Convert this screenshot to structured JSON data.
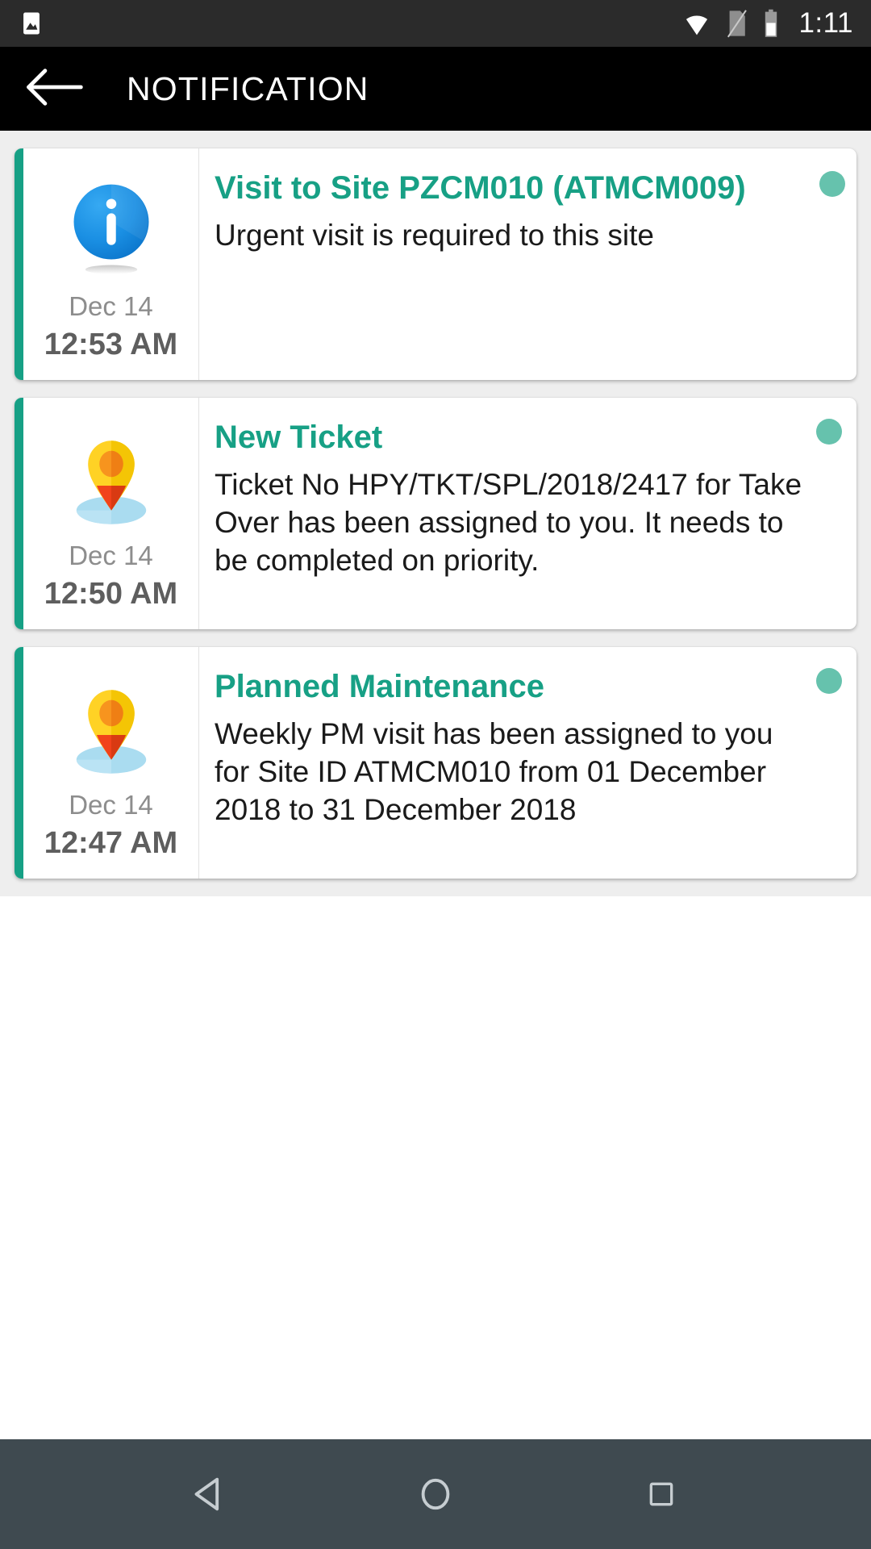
{
  "statusbar": {
    "time": "1:11",
    "icons": {
      "gallery": "gallery-icon",
      "wifi": "wifi-icon",
      "sim": "sim-card-off-icon",
      "battery": "battery-icon"
    }
  },
  "appbar": {
    "back_label": "back-arrow",
    "title": "NOTIFICATION"
  },
  "colors": {
    "accent_teal": "#16a085",
    "title_teal": "#17a085",
    "status_dot": "#66c2ad",
    "statusbar_bg": "#2b2b2b",
    "appbar_bg": "#000000",
    "list_bg": "#eeeeee",
    "navbar_bg": "#3f4a50",
    "info_icon_blue": "#1a8fe3",
    "pin_yellow": "#ffd225",
    "pin_orange": "#f7941e",
    "pin_tip_red": "#f1421b",
    "pin_shadow_blue": "#aadcf0"
  },
  "notifications": [
    {
      "icon": "info-circle-icon",
      "date": "Dec 14",
      "time": "12:53 AM",
      "title": "Visit to Site PZCM010 (ATMCM009)",
      "body": "Urgent visit is required to this site",
      "unread": true
    },
    {
      "icon": "map-pin-icon",
      "date": "Dec 14",
      "time": "12:50 AM",
      "title": "New Ticket",
      "body": "Ticket No HPY/TKT/SPL/2018/2417 for Take Over has been assigned to you. It needs to be completed on priority.",
      "unread": true
    },
    {
      "icon": "map-pin-icon",
      "date": "Dec 14",
      "time": "12:47 AM",
      "title": "Planned Maintenance",
      "body": "Weekly PM visit has been assigned to you for Site ID ATMCM010 from 01 December 2018 to 31 December 2018",
      "unread": true
    }
  ],
  "navbar": {
    "back": "back-triangle-icon",
    "home": "home-circle-icon",
    "recents": "recents-square-icon"
  }
}
